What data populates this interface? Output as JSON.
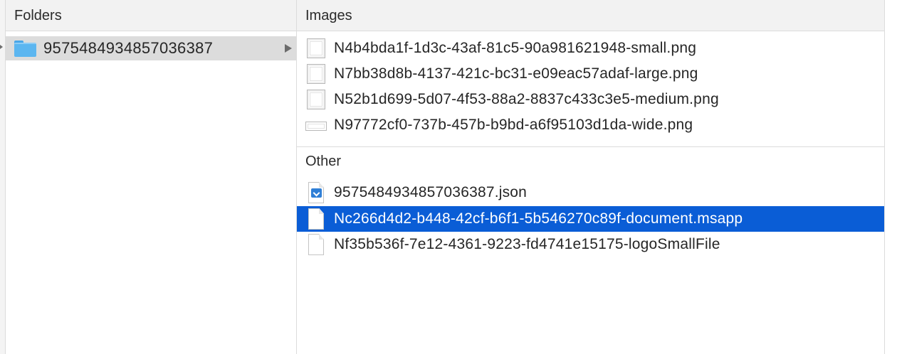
{
  "columns": {
    "folders": {
      "header": "Folders",
      "items": [
        {
          "label": "9575484934857036387",
          "icon": "folder-icon",
          "selected": true
        }
      ]
    },
    "images": {
      "header": "Images",
      "items": [
        {
          "label": "N4b4bda1f-1d3c-43af-81c5-90a981621948-small.png",
          "icon": "image-file-icon"
        },
        {
          "label": "N7bb38d8b-4137-421c-bc31-e09eac57adaf-large.png",
          "icon": "image-file-icon"
        },
        {
          "label": "N52b1d699-5d07-4f53-88a2-8837c433c3e5-medium.png",
          "icon": "image-file-icon"
        },
        {
          "label": "N97772cf0-737b-457b-b9bd-a6f95103d1da-wide.png",
          "icon": "wide-image-file-icon"
        }
      ]
    },
    "other": {
      "header": "Other",
      "items": [
        {
          "label": "9575484934857036387.json",
          "icon": "json-file-icon"
        },
        {
          "label": "Nc266d4d2-b448-42cf-b6f1-5b546270c89f-document.msapp",
          "icon": "document-file-icon",
          "selected": true
        },
        {
          "label": "Nf35b536f-7e12-4361-9223-fd4741e15175-logoSmallFile",
          "icon": "document-file-icon"
        }
      ]
    }
  },
  "colors": {
    "selection": "#0a5dd6",
    "folder_selection": "#dcdcdc",
    "folder_blue": "#5cb6f0",
    "header_bg": "#f2f2f2"
  }
}
